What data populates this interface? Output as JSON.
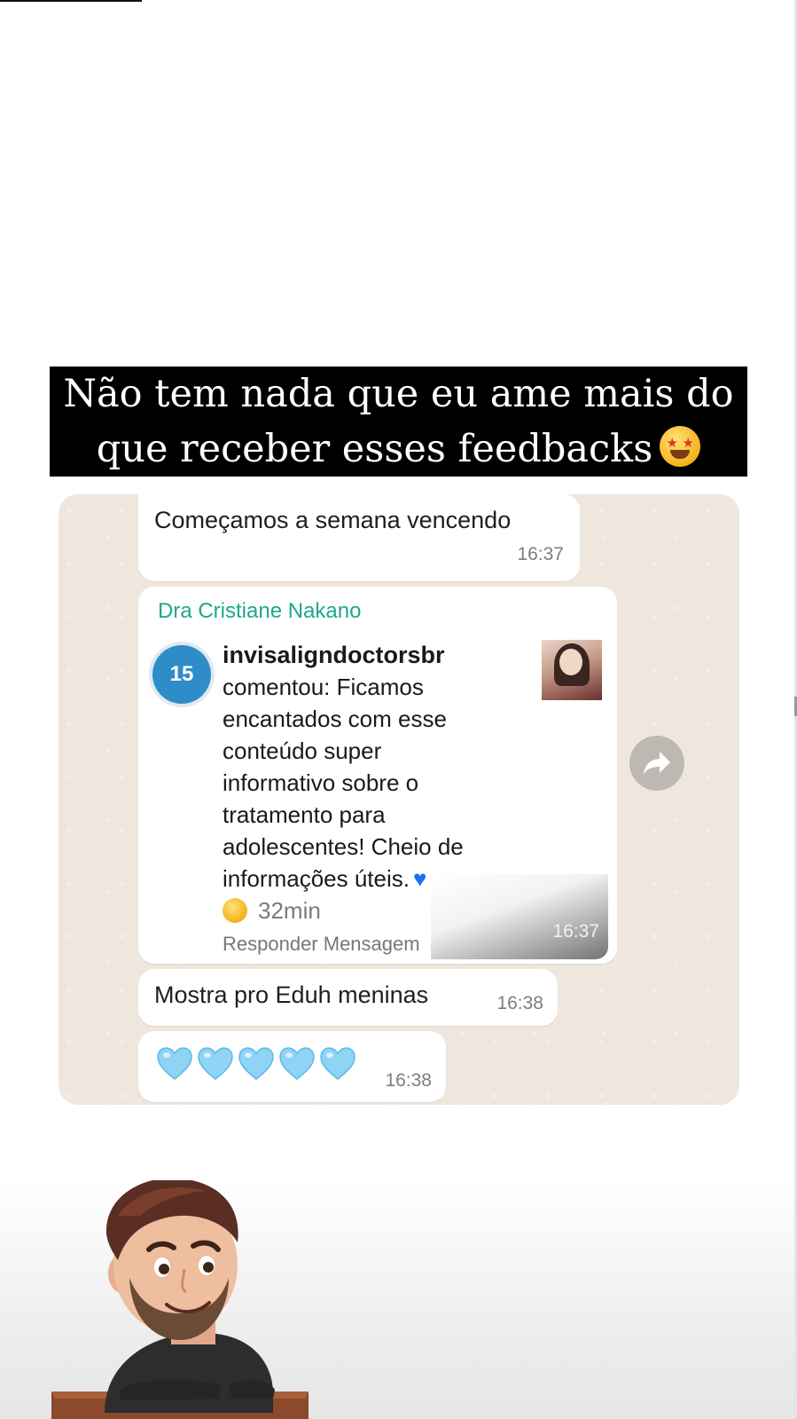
{
  "story": {
    "caption_line1": "Não tem nada que eu ame mais do",
    "caption_line2": "que receber esses feedbacks",
    "caption_emoji": "star-struck-emoji"
  },
  "chat": {
    "messages": [
      {
        "text": "Começamos a semana vencendo",
        "time": "16:37"
      },
      {
        "sender": "Dra Cristiane Nakano",
        "time": "16:37",
        "attachment": {
          "avatar_badge": "15",
          "username": "invisaligndoctorsbr",
          "lines": [
            "comentou: Ficamos",
            "encantados com esse",
            "conteúdo super",
            "informativo sobre o",
            "tratamento para",
            "adolescentes! Cheio de",
            "informações úteis."
          ],
          "age": "32min",
          "actions": "Responder  Mensagem"
        }
      },
      {
        "text": "Mostra pro Eduh meninas",
        "time": "16:38"
      },
      {
        "emoji": "light-blue-hearts",
        "count": 5,
        "time": "16:38"
      }
    ],
    "forward_icon": "share-arrow-icon"
  },
  "colors": {
    "sender_name": "#1fa78d",
    "chat_background": "#efe7dd",
    "caption_background": "#000000"
  }
}
